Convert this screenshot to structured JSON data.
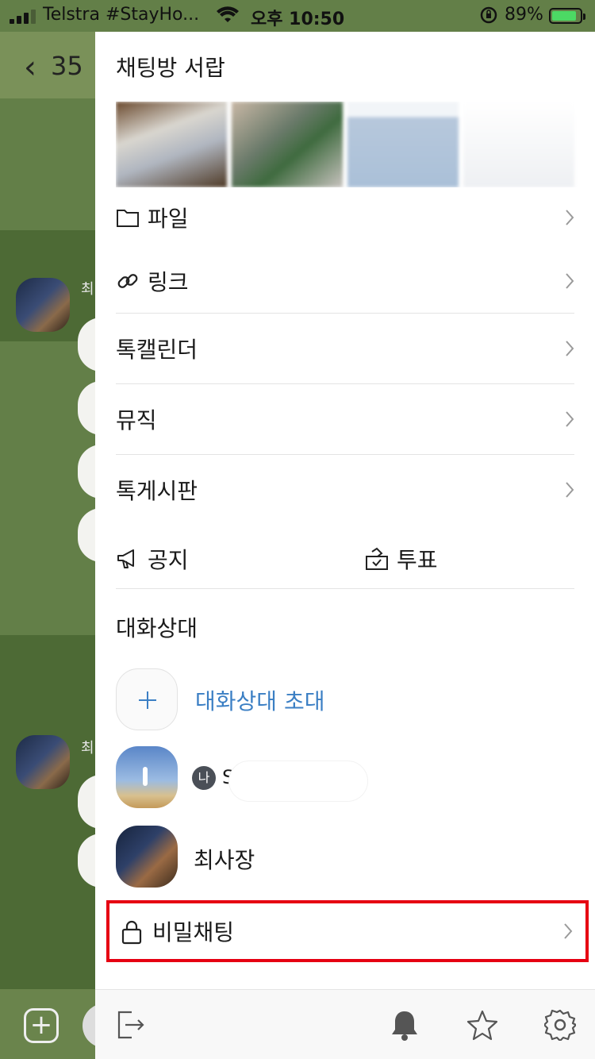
{
  "status_bar": {
    "carrier": "Telstra #StayHo...",
    "time": "오후 10:50",
    "battery_percent": "89%",
    "battery_level": 0.89,
    "battery_color": "#4cd964"
  },
  "background": {
    "back_count": "35",
    "sender_initial": "최"
  },
  "drawer": {
    "title": "채팅방 서랍",
    "menu": {
      "file": "파일",
      "link": "링크",
      "calendar": "톡캘린더",
      "music": "뮤직",
      "board": "톡게시판",
      "notice": "공지",
      "vote": "투표"
    },
    "members_section": "대화상대",
    "invite_label": "대화상대 초대",
    "members": [
      {
        "badge": "나",
        "name": "S"
      },
      {
        "name": "최사장"
      }
    ],
    "secret_chat": "비밀채팅",
    "accent_color": "#3b7fc4",
    "highlight_color": "#e60012"
  },
  "icons": {
    "file": "folder-icon",
    "link": "link-icon",
    "notice": "megaphone-icon",
    "vote": "ballot-box-icon",
    "secret": "lock-icon",
    "exit": "exit-icon",
    "bell": "bell-icon",
    "star": "star-icon",
    "settings": "gear-icon"
  }
}
